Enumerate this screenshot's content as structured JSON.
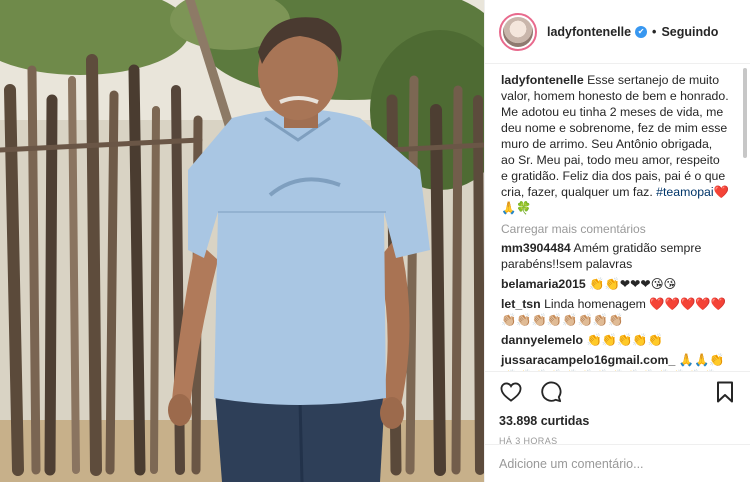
{
  "header": {
    "username": "ladyfontenelle",
    "verified_mark": "✔",
    "separator": "•",
    "follow_status": "Seguindo"
  },
  "caption": {
    "username": "ladyfontenelle",
    "text": "Esse sertanejo de muito valor, homem honesto de bem e honrado. Me adotou eu tinha 2 meses de vida, me deu nome e sobrenome, fez de mim esse muro de arrimo. Seu Antônio obrigada, ao Sr. Meu pai, todo meu amor, respeito e gratidão. Feliz dia dos pais, pai é o que cria, fazer, qualquer um faz.",
    "hashtag": "#teamopai",
    "emojis": "❤️ 🙏🍀"
  },
  "load_more": "Carregar mais comentários",
  "comments": [
    {
      "username": "mm3904484",
      "text": "Amém gratidão sempre parabéns!!sem palavras"
    },
    {
      "username": "belamaria2015",
      "text": "👏👏❤❤❤😘😘"
    },
    {
      "username": "let_tsn",
      "text": "Linda homenagem ❤️❤️❤️❤️❤️ 👏🏼👏🏼👏🏼👏🏼👏🏼👏🏼👏🏼👏🏼"
    },
    {
      "username": "dannyelemelo",
      "text": "👏👏👏👏👏"
    },
    {
      "username": "jussaracampelo16gmail.com_",
      "text": "🙏🙏👏👏👏👏👏👏👏👏👏👏👏👏👏👏👏👏👏👏👏👏👏👏👏👏👏👏👏👏👏"
    }
  ],
  "actions": {
    "like_icon": "heart-icon",
    "comment_icon": "speech-bubble-icon",
    "save_icon": "bookmark-icon"
  },
  "likes": "33.898 curtidas",
  "timestamp": "HÁ 3 HORAS",
  "add_comment": {
    "placeholder": "Adicione um comentário..."
  },
  "colors": {
    "accent_blue": "#3897f0",
    "hashtag": "#003569",
    "muted": "#999999",
    "border": "#efefef"
  }
}
